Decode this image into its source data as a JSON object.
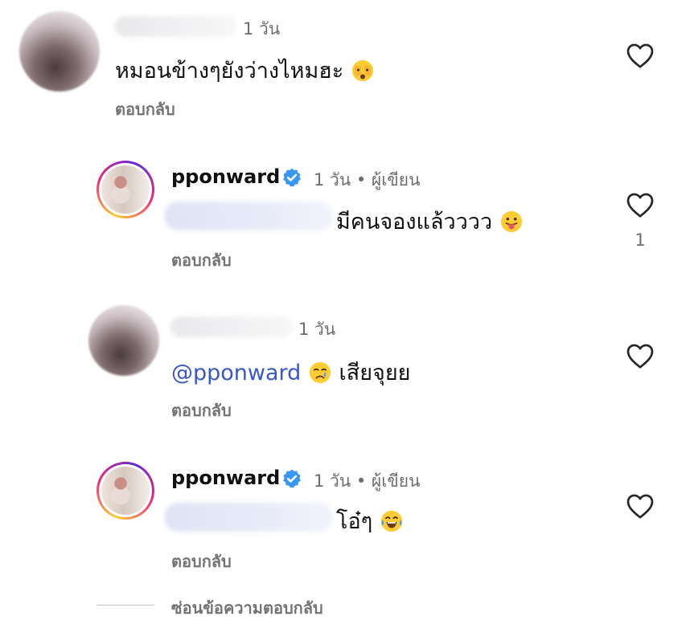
{
  "comments": [
    {
      "time": "1 วัน",
      "text": "หมอนข้างๆยังว่างไหมฮะ",
      "emoji_icon": "face-peeking-icon",
      "reply_label": "ตอบกลับ"
    },
    {
      "username": "pponward",
      "time_author": "1 วัน • ผู้เขียน",
      "text": "มีคนจองแล้วววว",
      "emoji_icon": "face-tongue-icon",
      "like_count": "1",
      "reply_label": "ตอบกลับ"
    },
    {
      "time": "1 วัน",
      "mention": "@pponward",
      "text": "เสียจุยย",
      "emoji_icon": "crying-face-icon",
      "reply_label": "ตอบกลับ"
    },
    {
      "username": "pponward",
      "time_author": "1 วัน • ผู้เขียน",
      "text": "โอ๋ๆ",
      "emoji_icon": "tears-of-joy-icon",
      "reply_label": "ตอบกลับ"
    }
  ],
  "hide_replies_label": "ซ่อนข้อความตอบกลับ",
  "colors": {
    "mention": "#3858c8",
    "verified": "#3897f0",
    "secondary_text": "#737373"
  }
}
